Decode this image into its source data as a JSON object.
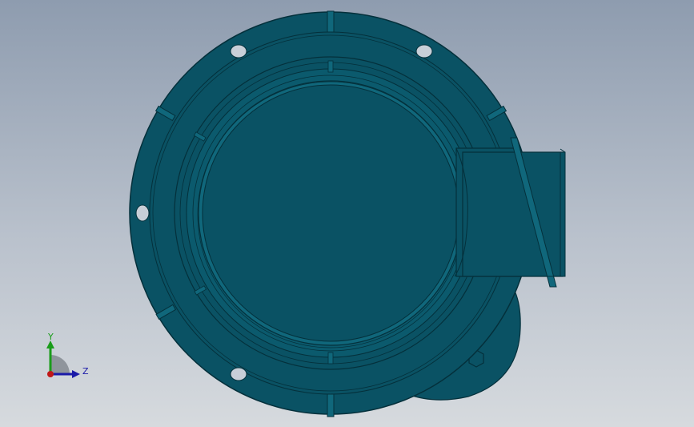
{
  "colors": {
    "background_top": "#8e9caf",
    "background_bottom": "#d6dade",
    "part_fill": "#0a5264",
    "part_fill_light": "#10677b",
    "part_edge": "#04303b",
    "hole_fill": "#c8cfd8",
    "axis_y": "#1a9c1a",
    "axis_z": "#1a1aa8",
    "axis_origin": "#c01818"
  },
  "triad": {
    "y_label": "Y",
    "z_label": "Z"
  }
}
